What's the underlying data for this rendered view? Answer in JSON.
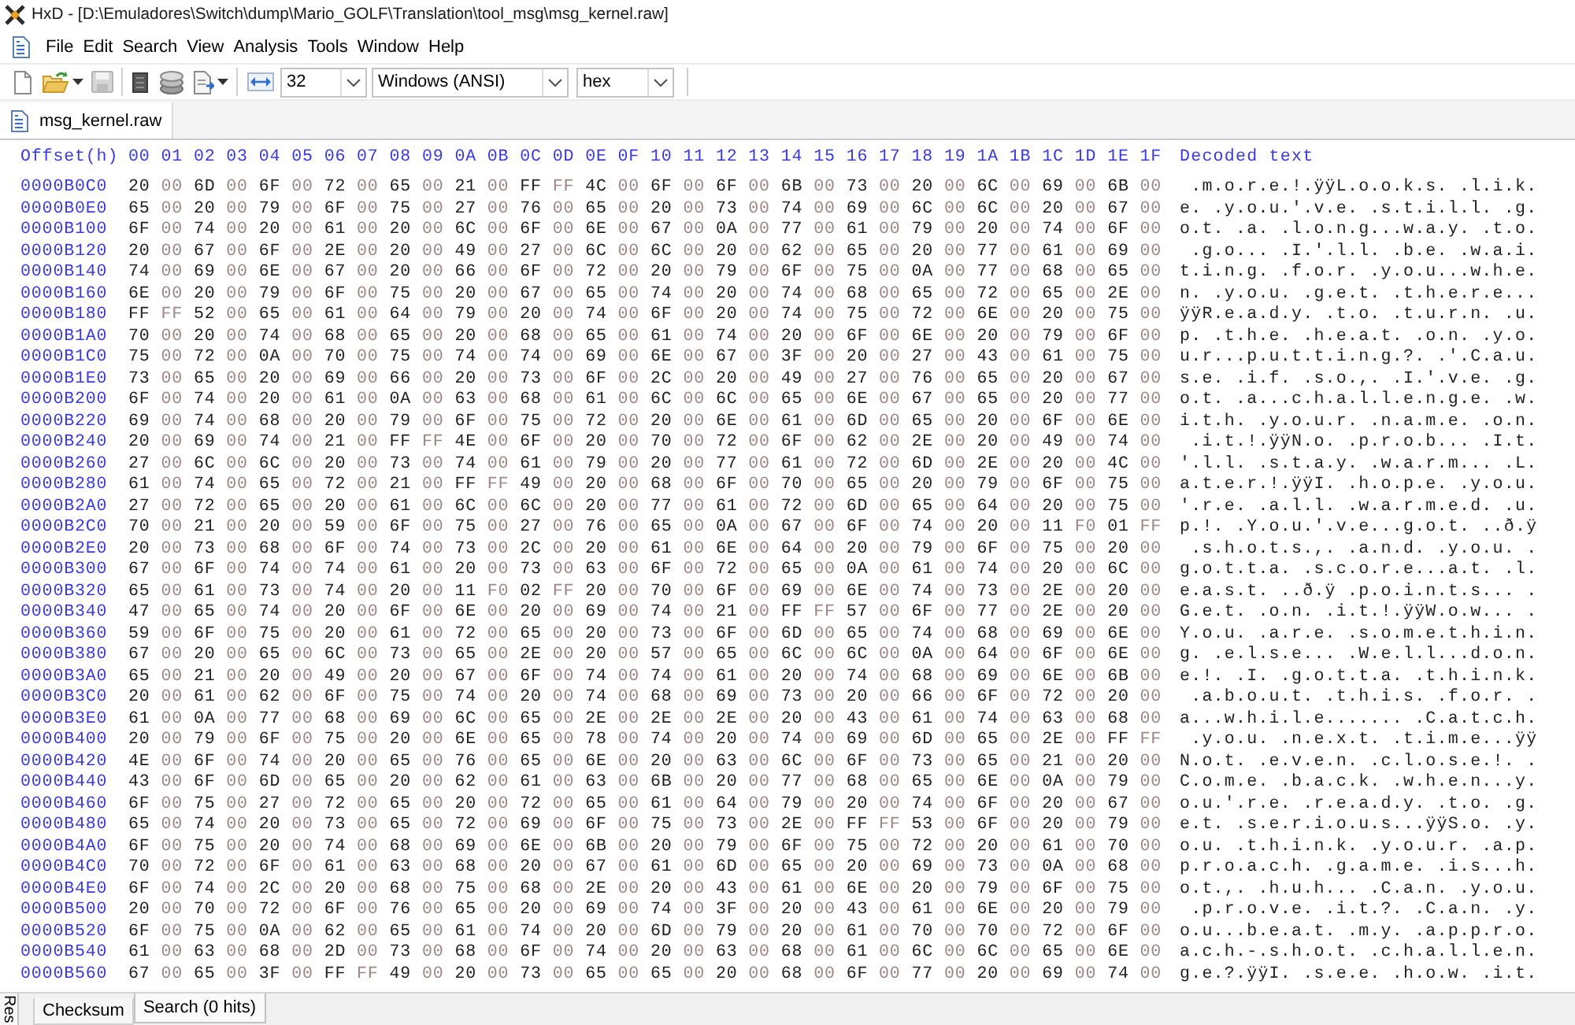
{
  "window": {
    "title": "HxD - [D:\\Emuladores\\Switch\\dump\\Mario_GOLF\\Translation\\tool_msg\\msg_kernel.raw]"
  },
  "menu": [
    "File",
    "Edit",
    "Search",
    "View",
    "Analysis",
    "Tools",
    "Window",
    "Help"
  ],
  "toolbar": {
    "dropdowns": [
      "32",
      "Windows (ANSI)",
      "hex"
    ]
  },
  "tabs": [
    {
      "label": "msg_kernel.raw",
      "selected": true
    }
  ],
  "editor": {
    "offset_header": "Offset(h)",
    "byte_columns": [
      "00",
      "01",
      "02",
      "03",
      "04",
      "05",
      "06",
      "07",
      "08",
      "09",
      "0A",
      "0B",
      "0C",
      "0D",
      "0E",
      "0F",
      "10",
      "11",
      "12",
      "13",
      "14",
      "15",
      "16",
      "17",
      "18",
      "19",
      "1A",
      "1B",
      "1C",
      "1D",
      "1E",
      "1F"
    ],
    "decoded_header": "Decoded text",
    "rows": [
      {
        "offset": "0000B0C0",
        "bytes": "20 00 6D 00 6F 00 72 00 65 00 21 00 FF FF 4C 00 6F 00 6F 00 6B 00 73 00 20 00 6C 00 69 00 6B 00",
        "decoded": " .m.o.r.e.!.ÿÿL.o.o.k.s. .l.i.k."
      },
      {
        "offset": "0000B0E0",
        "bytes": "65 00 20 00 79 00 6F 00 75 00 27 00 76 00 65 00 20 00 73 00 74 00 69 00 6C 00 6C 00 20 00 67 00",
        "decoded": "e. .y.o.u.'.v.e. .s.t.i.l.l. .g."
      },
      {
        "offset": "0000B100",
        "bytes": "6F 00 74 00 20 00 61 00 20 00 6C 00 6F 00 6E 00 67 00 0A 00 77 00 61 00 79 00 20 00 74 00 6F 00",
        "decoded": "o.t. .a. .l.o.n.g...w.a.y. .t.o."
      },
      {
        "offset": "0000B120",
        "bytes": "20 00 67 00 6F 00 2E 00 20 00 49 00 27 00 6C 00 6C 00 20 00 62 00 65 00 20 00 77 00 61 00 69 00",
        "decoded": " .g.o... .I.'.l.l. .b.e. .w.a.i."
      },
      {
        "offset": "0000B140",
        "bytes": "74 00 69 00 6E 00 67 00 20 00 66 00 6F 00 72 00 20 00 79 00 6F 00 75 00 0A 00 77 00 68 00 65 00",
        "decoded": "t.i.n.g. .f.o.r. .y.o.u...w.h.e."
      },
      {
        "offset": "0000B160",
        "bytes": "6E 00 20 00 79 00 6F 00 75 00 20 00 67 00 65 00 74 00 20 00 74 00 68 00 65 00 72 00 65 00 2E 00",
        "decoded": "n. .y.o.u. .g.e.t. .t.h.e.r.e..."
      },
      {
        "offset": "0000B180",
        "bytes": "FF FF 52 00 65 00 61 00 64 00 79 00 20 00 74 00 6F 00 20 00 74 00 75 00 72 00 6E 00 20 00 75 00",
        "decoded": "ÿÿR.e.a.d.y. .t.o. .t.u.r.n. .u."
      },
      {
        "offset": "0000B1A0",
        "bytes": "70 00 20 00 74 00 68 00 65 00 20 00 68 00 65 00 61 00 74 00 20 00 6F 00 6E 00 20 00 79 00 6F 00",
        "decoded": "p. .t.h.e. .h.e.a.t. .o.n. .y.o."
      },
      {
        "offset": "0000B1C0",
        "bytes": "75 00 72 00 0A 00 70 00 75 00 74 00 74 00 69 00 6E 00 67 00 3F 00 20 00 27 00 43 00 61 00 75 00",
        "decoded": "u.r...p.u.t.t.i.n.g.?. .'.C.a.u."
      },
      {
        "offset": "0000B1E0",
        "bytes": "73 00 65 00 20 00 69 00 66 00 20 00 73 00 6F 00 2C 00 20 00 49 00 27 00 76 00 65 00 20 00 67 00",
        "decoded": "s.e. .i.f. .s.o.,. .I.'.v.e. .g."
      },
      {
        "offset": "0000B200",
        "bytes": "6F 00 74 00 20 00 61 00 0A 00 63 00 68 00 61 00 6C 00 6C 00 65 00 6E 00 67 00 65 00 20 00 77 00",
        "decoded": "o.t. .a...c.h.a.l.l.e.n.g.e. .w."
      },
      {
        "offset": "0000B220",
        "bytes": "69 00 74 00 68 00 20 00 79 00 6F 00 75 00 72 00 20 00 6E 00 61 00 6D 00 65 00 20 00 6F 00 6E 00",
        "decoded": "i.t.h. .y.o.u.r. .n.a.m.e. .o.n."
      },
      {
        "offset": "0000B240",
        "bytes": "20 00 69 00 74 00 21 00 FF FF 4E 00 6F 00 20 00 70 00 72 00 6F 00 62 00 2E 00 20 00 49 00 74 00",
        "decoded": " .i.t.!.ÿÿN.o. .p.r.o.b... .I.t."
      },
      {
        "offset": "0000B260",
        "bytes": "27 00 6C 00 6C 00 20 00 73 00 74 00 61 00 79 00 20 00 77 00 61 00 72 00 6D 00 2E 00 20 00 4C 00",
        "decoded": "'.l.l. .s.t.a.y. .w.a.r.m... .L."
      },
      {
        "offset": "0000B280",
        "bytes": "61 00 74 00 65 00 72 00 21 00 FF FF 49 00 20 00 68 00 6F 00 70 00 65 00 20 00 79 00 6F 00 75 00",
        "decoded": "a.t.e.r.!.ÿÿI. .h.o.p.e. .y.o.u."
      },
      {
        "offset": "0000B2A0",
        "bytes": "27 00 72 00 65 00 20 00 61 00 6C 00 6C 00 20 00 77 00 61 00 72 00 6D 00 65 00 64 00 20 00 75 00",
        "decoded": "'.r.e. .a.l.l. .w.a.r.m.e.d. .u."
      },
      {
        "offset": "0000B2C0",
        "bytes": "70 00 21 00 20 00 59 00 6F 00 75 00 27 00 76 00 65 00 0A 00 67 00 6F 00 74 00 20 00 11 F0 01 FF",
        "decoded": "p.!. .Y.o.u.'.v.e...g.o.t. ..ð.ÿ"
      },
      {
        "offset": "0000B2E0",
        "bytes": "20 00 73 00 68 00 6F 00 74 00 73 00 2C 00 20 00 61 00 6E 00 64 00 20 00 79 00 6F 00 75 00 20 00",
        "decoded": " .s.h.o.t.s.,. .a.n.d. .y.o.u. ."
      },
      {
        "offset": "0000B300",
        "bytes": "67 00 6F 00 74 00 74 00 61 00 20 00 73 00 63 00 6F 00 72 00 65 00 0A 00 61 00 74 00 20 00 6C 00",
        "decoded": "g.o.t.t.a. .s.c.o.r.e...a.t. .l."
      },
      {
        "offset": "0000B320",
        "bytes": "65 00 61 00 73 00 74 00 20 00 11 F0 02 FF 20 00 70 00 6F 00 69 00 6E 00 74 00 73 00 2E 00 20 00",
        "decoded": "e.a.s.t. ..ð.ÿ .p.o.i.n.t.s... ."
      },
      {
        "offset": "0000B340",
        "bytes": "47 00 65 00 74 00 20 00 6F 00 6E 00 20 00 69 00 74 00 21 00 FF FF 57 00 6F 00 77 00 2E 00 20 00",
        "decoded": "G.e.t. .o.n. .i.t.!.ÿÿW.o.w... ."
      },
      {
        "offset": "0000B360",
        "bytes": "59 00 6F 00 75 00 20 00 61 00 72 00 65 00 20 00 73 00 6F 00 6D 00 65 00 74 00 68 00 69 00 6E 00",
        "decoded": "Y.o.u. .a.r.e. .s.o.m.e.t.h.i.n."
      },
      {
        "offset": "0000B380",
        "bytes": "67 00 20 00 65 00 6C 00 73 00 65 00 2E 00 20 00 57 00 65 00 6C 00 6C 00 0A 00 64 00 6F 00 6E 00",
        "decoded": "g. .e.l.s.e... .W.e.l.l...d.o.n."
      },
      {
        "offset": "0000B3A0",
        "bytes": "65 00 21 00 20 00 49 00 20 00 67 00 6F 00 74 00 74 00 61 00 20 00 74 00 68 00 69 00 6E 00 6B 00",
        "decoded": "e.!. .I. .g.o.t.t.a. .t.h.i.n.k."
      },
      {
        "offset": "0000B3C0",
        "bytes": "20 00 61 00 62 00 6F 00 75 00 74 00 20 00 74 00 68 00 69 00 73 00 20 00 66 00 6F 00 72 00 20 00",
        "decoded": " .a.b.o.u.t. .t.h.i.s. .f.o.r. ."
      },
      {
        "offset": "0000B3E0",
        "bytes": "61 00 0A 00 77 00 68 00 69 00 6C 00 65 00 2E 00 2E 00 2E 00 20 00 43 00 61 00 74 00 63 00 68 00",
        "decoded": "a...w.h.i.l.e....... .C.a.t.c.h."
      },
      {
        "offset": "0000B400",
        "bytes": "20 00 79 00 6F 00 75 00 20 00 6E 00 65 00 78 00 74 00 20 00 74 00 69 00 6D 00 65 00 2E 00 FF FF",
        "decoded": " .y.o.u. .n.e.x.t. .t.i.m.e...ÿÿ"
      },
      {
        "offset": "0000B420",
        "bytes": "4E 00 6F 00 74 00 20 00 65 00 76 00 65 00 6E 00 20 00 63 00 6C 00 6F 00 73 00 65 00 21 00 20 00",
        "decoded": "N.o.t. .e.v.e.n. .c.l.o.s.e.!. ."
      },
      {
        "offset": "0000B440",
        "bytes": "43 00 6F 00 6D 00 65 00 20 00 62 00 61 00 63 00 6B 00 20 00 77 00 68 00 65 00 6E 00 0A 00 79 00",
        "decoded": "C.o.m.e. .b.a.c.k. .w.h.e.n...y."
      },
      {
        "offset": "0000B460",
        "bytes": "6F 00 75 00 27 00 72 00 65 00 20 00 72 00 65 00 61 00 64 00 79 00 20 00 74 00 6F 00 20 00 67 00",
        "decoded": "o.u.'.r.e. .r.e.a.d.y. .t.o. .g."
      },
      {
        "offset": "0000B480",
        "bytes": "65 00 74 00 20 00 73 00 65 00 72 00 69 00 6F 00 75 00 73 00 2E 00 FF FF 53 00 6F 00 20 00 79 00",
        "decoded": "e.t. .s.e.r.i.o.u.s...ÿÿS.o. .y."
      },
      {
        "offset": "0000B4A0",
        "bytes": "6F 00 75 00 20 00 74 00 68 00 69 00 6E 00 6B 00 20 00 79 00 6F 00 75 00 72 00 20 00 61 00 70 00",
        "decoded": "o.u. .t.h.i.n.k. .y.o.u.r. .a.p."
      },
      {
        "offset": "0000B4C0",
        "bytes": "70 00 72 00 6F 00 61 00 63 00 68 00 20 00 67 00 61 00 6D 00 65 00 20 00 69 00 73 00 0A 00 68 00",
        "decoded": "p.r.o.a.c.h. .g.a.m.e. .i.s...h."
      },
      {
        "offset": "0000B4E0",
        "bytes": "6F 00 74 00 2C 00 20 00 68 00 75 00 68 00 2E 00 20 00 43 00 61 00 6E 00 20 00 79 00 6F 00 75 00",
        "decoded": "o.t.,. .h.u.h... .C.a.n. .y.o.u."
      },
      {
        "offset": "0000B500",
        "bytes": "20 00 70 00 72 00 6F 00 76 00 65 00 20 00 69 00 74 00 3F 00 20 00 43 00 61 00 6E 00 20 00 79 00",
        "decoded": " .p.r.o.v.e. .i.t.?. .C.a.n. .y."
      },
      {
        "offset": "0000B520",
        "bytes": "6F 00 75 00 0A 00 62 00 65 00 61 00 74 00 20 00 6D 00 79 00 20 00 61 00 70 00 70 00 72 00 6F 00",
        "decoded": "o.u...b.e.a.t. .m.y. .a.p.p.r.o."
      },
      {
        "offset": "0000B540",
        "bytes": "61 00 63 00 68 00 2D 00 73 00 68 00 6F 00 74 00 20 00 63 00 68 00 61 00 6C 00 6C 00 65 00 6E 00",
        "decoded": "a.c.h.-.s.h.o.t. .c.h.a.l.l.e.n."
      },
      {
        "offset": "0000B560",
        "bytes": "67 00 65 00 3F 00 FF FF 49 00 20 00 73 00 65 00 65 00 20 00 68 00 6F 00 77 00 20 00 69 00 74 00",
        "decoded": "g.e.?.ÿÿI. .s.e.e. .h.o.w. .i.t."
      }
    ]
  },
  "bottom_panel": {
    "side_tab": "Res",
    "tabs": [
      {
        "label": "Checksum",
        "selected": false
      },
      {
        "label": "Search (0 hits)",
        "selected": true
      }
    ]
  }
}
